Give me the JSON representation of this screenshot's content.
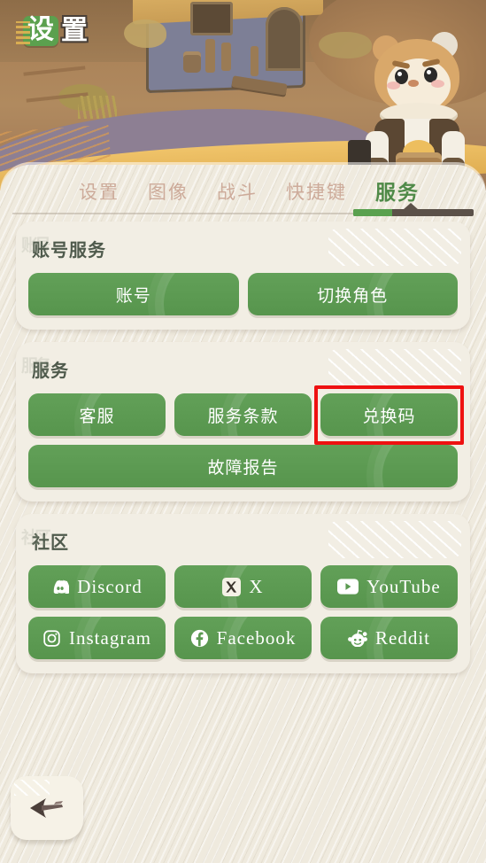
{
  "header": {
    "logo_char_1": "设",
    "logo_char_2": "置",
    "logo_full": "设置"
  },
  "tabs": [
    {
      "label": "设置",
      "active": false
    },
    {
      "label": "图像",
      "active": false
    },
    {
      "label": "战斗",
      "active": false
    },
    {
      "label": "快捷键",
      "active": false
    },
    {
      "label": "服务",
      "active": true
    }
  ],
  "sections": [
    {
      "title": "账号服务",
      "watermark": "账号",
      "rows": [
        [
          {
            "label": "账号"
          },
          {
            "label": "切换角色"
          }
        ]
      ]
    },
    {
      "title": "服务",
      "watermark": "服务",
      "rows": [
        [
          {
            "label": "客服"
          },
          {
            "label": "服务条款"
          },
          {
            "label": "兑换码",
            "highlighted": true
          }
        ],
        [
          {
            "label": "故障报告"
          }
        ]
      ]
    },
    {
      "title": "社区",
      "watermark": "社区",
      "rows": [
        [
          {
            "label": "Discord",
            "icon": "discord-icon"
          },
          {
            "label": "X",
            "icon": "x-twitter-icon"
          },
          {
            "label": "YouTube",
            "icon": "youtube-icon"
          }
        ],
        [
          {
            "label": "Instagram",
            "icon": "instagram-icon"
          },
          {
            "label": "Facebook",
            "icon": "facebook-icon"
          },
          {
            "label": "Reddit",
            "icon": "reddit-icon"
          }
        ]
      ]
    }
  ],
  "back_button": {
    "icon": "back-arrow-icon",
    "label": ""
  },
  "colors": {
    "button_green": "#5b9a51",
    "active_tab_green": "#4f8a48",
    "inactive_tab": "#cdab9a",
    "highlight_red": "#ee1111",
    "panel_bg": "#efeade",
    "card_bg": "#f2eee4",
    "underline_dark": "#5b5149"
  }
}
